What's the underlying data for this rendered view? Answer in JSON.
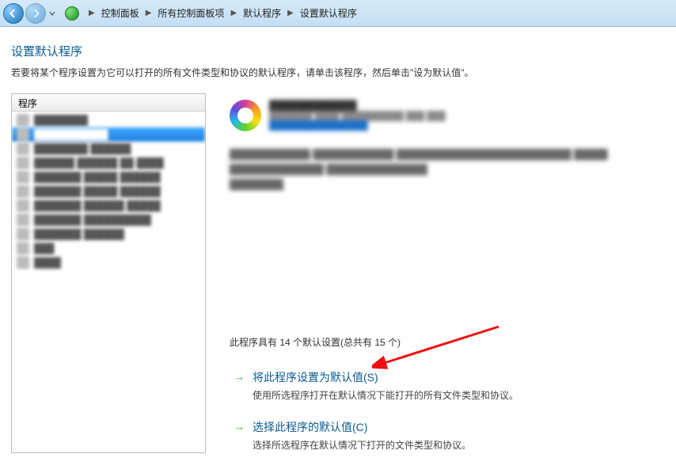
{
  "breadcrumb": {
    "items": [
      "控制面板",
      "所有控制面板项",
      "默认程序",
      "设置默认程序"
    ]
  },
  "page": {
    "title": "设置默认程序",
    "desc_prefix": "若要将某个程序设置为它可以打开的所有文件类型和协议的默认程序，请单击该程序，然后单击",
    "desc_quote": "\"设为默认值\"",
    "desc_suffix": "。"
  },
  "programs": {
    "header": "程序"
  },
  "detail": {
    "defaults_line": "此程序具有 14 个默认设置(总共有 15 个)"
  },
  "actions": {
    "set_default": {
      "title": "将此程序设置为默认值(S)",
      "sub": "使用所选程序打开在默认情况下能打开的所有文件类型和协议。"
    },
    "choose_defaults": {
      "title": "选择此程序的默认值(C)",
      "sub": "选择所选程序在默认情况下打开的文件类型和协议。"
    }
  }
}
